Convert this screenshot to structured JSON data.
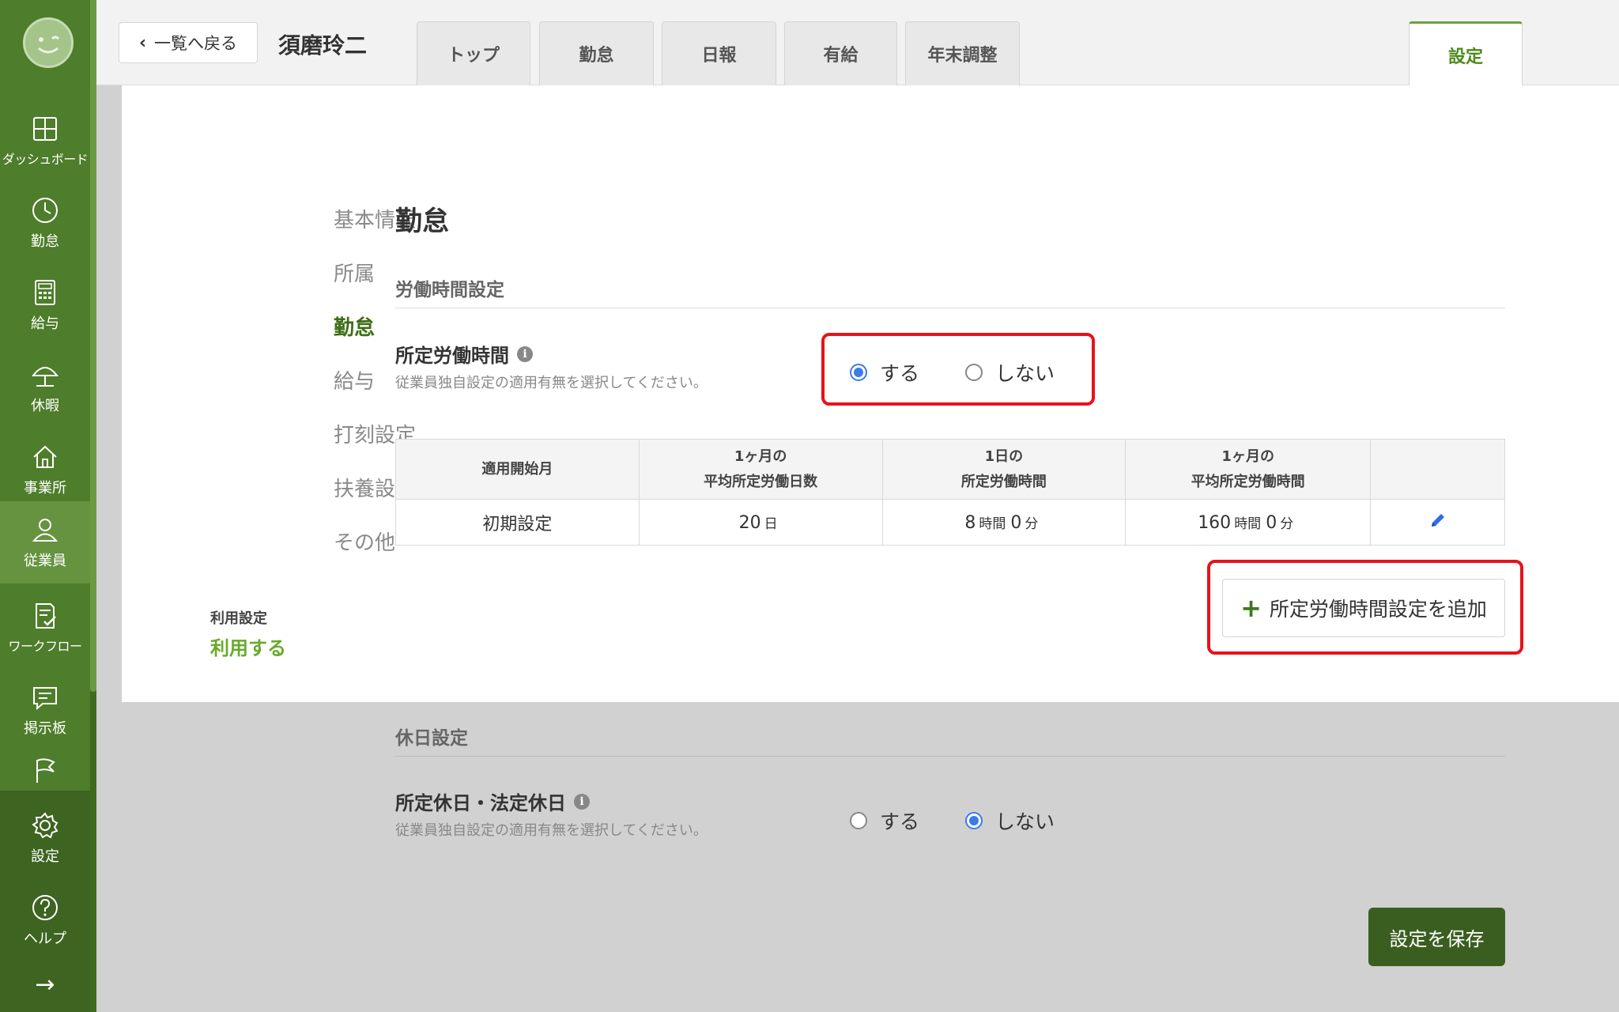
{
  "header": {
    "back_label": "一覧へ戻る",
    "employee_name": "須磨玲二",
    "tabs": [
      {
        "label": "トップ"
      },
      {
        "label": "勤怠"
      },
      {
        "label": "日報"
      },
      {
        "label": "有給"
      },
      {
        "label": "年末調整"
      },
      {
        "label": "設定"
      }
    ],
    "active_tab": "設定"
  },
  "sidebar": {
    "items": [
      {
        "label": "ダッシュボード",
        "icon": "dashboard-icon"
      },
      {
        "label": "勤怠",
        "icon": "clock-icon"
      },
      {
        "label": "給与",
        "icon": "calculator-icon"
      },
      {
        "label": "休暇",
        "icon": "umbrella-icon"
      },
      {
        "label": "事業所",
        "icon": "home-icon"
      },
      {
        "label": "従業員",
        "icon": "person-icon"
      },
      {
        "label": "ワークフロー",
        "icon": "checklist-icon"
      },
      {
        "label": "掲示板",
        "icon": "chat-icon"
      },
      {
        "label": "",
        "icon": "flag-icon"
      },
      {
        "label": "設定",
        "icon": "gear-icon"
      },
      {
        "label": "ヘルプ",
        "icon": "help-icon"
      }
    ],
    "active": "従業員",
    "expand_icon": "arrow-right-icon"
  },
  "settings_menu": {
    "items": [
      {
        "label": "基本情報"
      },
      {
        "label": "所属"
      },
      {
        "label": "勤怠"
      },
      {
        "label": "給与"
      },
      {
        "label": "打刻設定"
      },
      {
        "label": "扶養設定"
      },
      {
        "label": "その他"
      }
    ],
    "active": "勤怠",
    "usage_label": "利用設定",
    "usage_value": "利用する"
  },
  "main": {
    "section_title": "勤怠",
    "working_hours": {
      "title": "労働時間設定",
      "field_label": "所定労働時間",
      "help": "従業員独自設定の適用有無を選択してください。",
      "options": [
        {
          "label": "する",
          "selected": true
        },
        {
          "label": "しない",
          "selected": false
        }
      ],
      "table": {
        "headers": [
          {
            "line1": "適用開始月",
            "line2": ""
          },
          {
            "line1": "1ヶ月の",
            "line2": "平均所定労働日数"
          },
          {
            "line1": "1日の",
            "line2": "所定労働時間"
          },
          {
            "line1": "1ヶ月の",
            "line2": "平均所定労働時間"
          },
          {
            "line1": "",
            "line2": ""
          }
        ],
        "rows": [
          {
            "start": "初期設定",
            "days": "20",
            "days_unit": "日",
            "daily_h": "8",
            "daily_h_unit": "時間",
            "daily_m": "0",
            "daily_m_unit": "分",
            "monthly_h": "160",
            "monthly_h_unit": "時間",
            "monthly_m": "0",
            "monthly_m_unit": "分",
            "edit_icon": "pencil-icon"
          }
        ]
      },
      "add_button": "所定労働時間設定を追加"
    },
    "holiday": {
      "title": "休日設定",
      "field_label": "所定休日・法定休日",
      "help": "従業員独自設定の適用有無を選択してください。",
      "options": [
        {
          "label": "する",
          "selected": false
        },
        {
          "label": "しない",
          "selected": true
        }
      ]
    },
    "save_button": "設定を保存"
  },
  "colors": {
    "sidebar_green": "#4e7d2b",
    "accent_green": "#67ab2a",
    "save_button": "#3a5e1f",
    "highlight_red": "#e8121a",
    "radio_blue": "#3b7bea"
  }
}
